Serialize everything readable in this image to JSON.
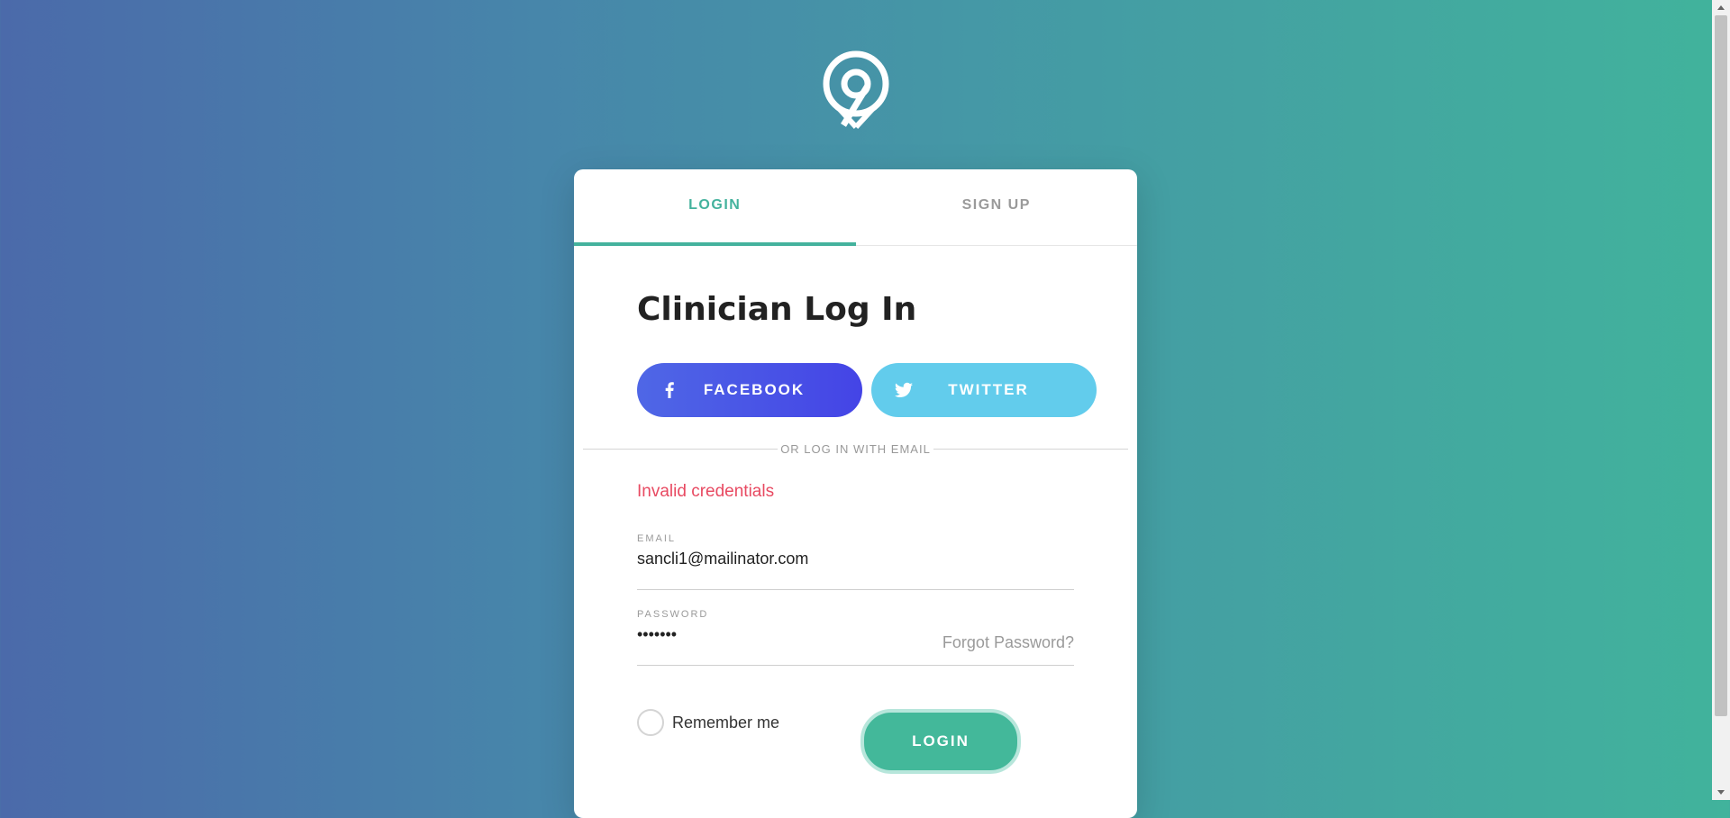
{
  "logo": {
    "icon": "location-pin-logo-icon",
    "color": "#ffffff"
  },
  "tabs": [
    {
      "label": "LOGIN",
      "active": true
    },
    {
      "label": "SIGN UP",
      "active": false
    }
  ],
  "form": {
    "title": "Clinician Log In",
    "social": {
      "facebook_label": "FACEBOOK",
      "facebook_icon": "facebook-icon",
      "twitter_label": "TWITTER",
      "twitter_icon": "twitter-icon"
    },
    "divider_text": "OR LOG IN WITH EMAIL",
    "error": "Invalid credentials",
    "email": {
      "label": "EMAIL",
      "value": "sancli1@mailinator.com"
    },
    "password": {
      "label": "PASSWORD",
      "value": "•••••••",
      "forgot": "Forgot Password?"
    },
    "remember_label": "Remember me",
    "login_label": "LOGIN"
  },
  "colors": {
    "accent": "#44b29d",
    "error": "#e84a62",
    "facebook": "#4444e6",
    "twitter": "#62ccec",
    "login_button": "#43b89a"
  }
}
